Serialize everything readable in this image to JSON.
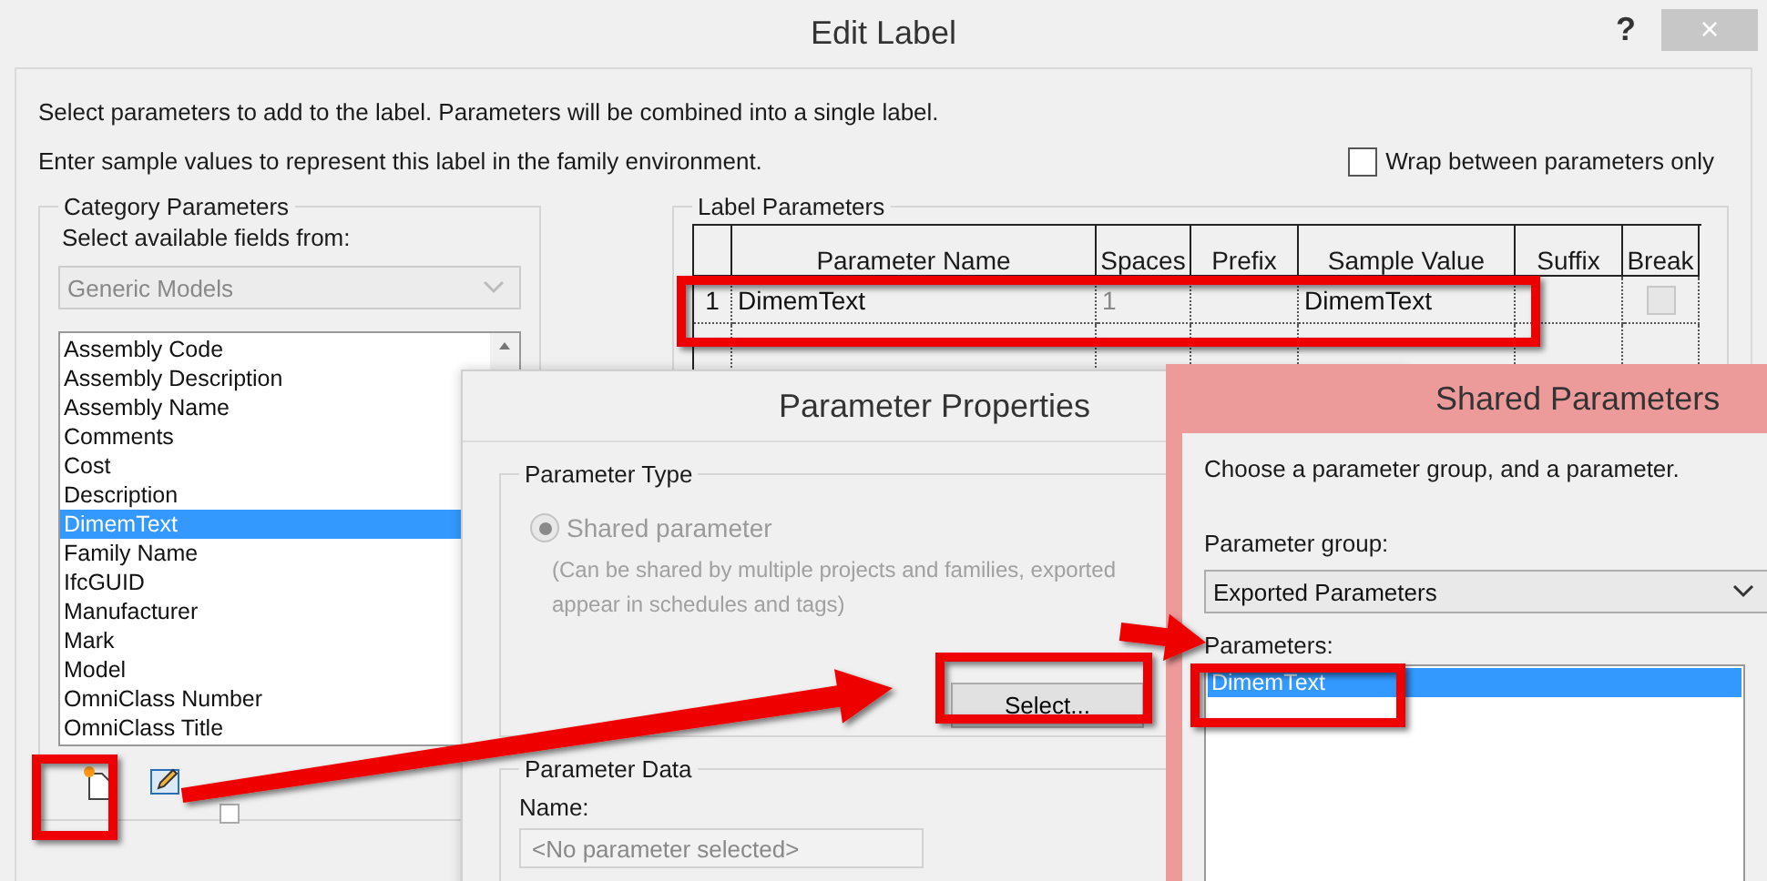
{
  "edit_label": {
    "title": "Edit Label",
    "help": "?",
    "close": "×",
    "instructions": [
      "Select parameters to add to the label.  Parameters will be combined into a single label.",
      "Enter sample values to represent this label in the family environment."
    ],
    "wrap_option": {
      "label": "Wrap between parameters only",
      "checked": false
    },
    "category_parameters": {
      "title": "Category Parameters",
      "fields_label": "Select available fields from:",
      "category": "Generic Models",
      "items": [
        {
          "label": "Assembly Code",
          "selected": false
        },
        {
          "label": "Assembly Description",
          "selected": false
        },
        {
          "label": "Assembly Name",
          "selected": false
        },
        {
          "label": "Comments",
          "selected": false
        },
        {
          "label": "Cost",
          "selected": false
        },
        {
          "label": "Description",
          "selected": false
        },
        {
          "label": "DimemText",
          "selected": true
        },
        {
          "label": "Family Name",
          "selected": false
        },
        {
          "label": "IfcGUID",
          "selected": false
        },
        {
          "label": "Manufacturer",
          "selected": false
        },
        {
          "label": "Mark",
          "selected": false
        },
        {
          "label": "Model",
          "selected": false
        },
        {
          "label": "OmniClass Number",
          "selected": false
        },
        {
          "label": "OmniClass Title",
          "selected": false
        }
      ]
    },
    "label_parameters": {
      "title": "Label Parameters",
      "columns": [
        "Parameter Name",
        "Spaces",
        "Prefix",
        "Sample Value",
        "Suffix",
        "Break"
      ],
      "rows": [
        {
          "number": "1",
          "parameter_name": "DimemText",
          "spaces": "1",
          "sample_value": "DimemText",
          "break": false
        }
      ]
    }
  },
  "parameter_properties": {
    "title": "Parameter Properties",
    "type_group": "Parameter Type",
    "option": {
      "label": "Shared parameter",
      "selected": true,
      "disabled": true
    },
    "note_lines": [
      "(Can be shared by multiple projects and families, exported",
      "appear in schedules and tags)"
    ],
    "select_button": "Select...",
    "data_group": "Parameter Data",
    "name_label": "Name:",
    "name_placeholder": "<No parameter selected>"
  },
  "shared_parameters": {
    "title": "Shared Parameters",
    "instruction": "Choose a parameter group, and a parameter.",
    "group_label": "Parameter group:",
    "group_value": "Exported Parameters",
    "parameters_label": "Parameters:",
    "parameters": [
      {
        "label": "DimemText",
        "selected": true
      }
    ]
  }
}
